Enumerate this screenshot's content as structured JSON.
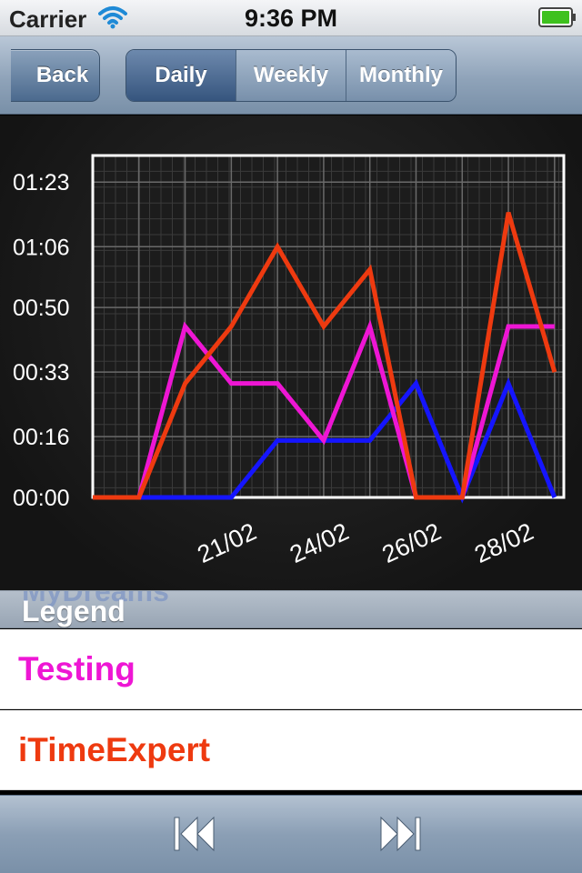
{
  "status_bar": {
    "carrier": "Carrier",
    "time": "9:36 PM"
  },
  "nav": {
    "back_label": "Back",
    "segments": [
      "Daily",
      "Weekly",
      "Monthly"
    ],
    "selected_segment": "Daily"
  },
  "legend": {
    "header": "Legend",
    "partially_hidden_item": "MyDreams",
    "items": [
      {
        "label": "Testing",
        "color": "#ee16d4"
      },
      {
        "label": "iTimeExpert",
        "color": "#ee3a10"
      }
    ]
  },
  "toolbar": {
    "icons": [
      "rewind-icon",
      "fast-forward-icon"
    ]
  },
  "chart_data": {
    "type": "line",
    "y_tick_labels": [
      "00:00",
      "00:16",
      "00:33",
      "00:50",
      "01:06",
      "01:23"
    ],
    "y_ticks_seconds": [
      0,
      16,
      33,
      50,
      66,
      83
    ],
    "ylim": [
      0,
      90
    ],
    "x_tick_labels": [
      "21/02",
      "24/02",
      "26/02",
      "28/02"
    ],
    "x_tick_positions": [
      2,
      4,
      6,
      8
    ],
    "xlim": [
      -1,
      9.2
    ],
    "grid": true,
    "series": [
      {
        "name": "MyDreams",
        "color": "#1515ff",
        "x": [
          -1,
          0,
          1,
          2,
          3,
          4,
          5,
          6,
          7,
          8,
          9
        ],
        "values": [
          0,
          0,
          0,
          0,
          15,
          15,
          15,
          30,
          0,
          30,
          0
        ]
      },
      {
        "name": "Testing",
        "color": "#ee16d4",
        "x": [
          -1,
          0,
          1,
          2,
          3,
          4,
          5,
          6,
          7,
          8,
          9
        ],
        "values": [
          0,
          0,
          45,
          30,
          30,
          15,
          45,
          0,
          0,
          45,
          45
        ]
      },
      {
        "name": "iTimeExpert",
        "color": "#ee3a10",
        "x": [
          -1,
          0,
          1,
          2,
          3,
          4,
          5,
          6,
          7,
          8,
          9
        ],
        "values": [
          0,
          0,
          30,
          45,
          66,
          45,
          60,
          0,
          0,
          75,
          33
        ]
      }
    ]
  }
}
